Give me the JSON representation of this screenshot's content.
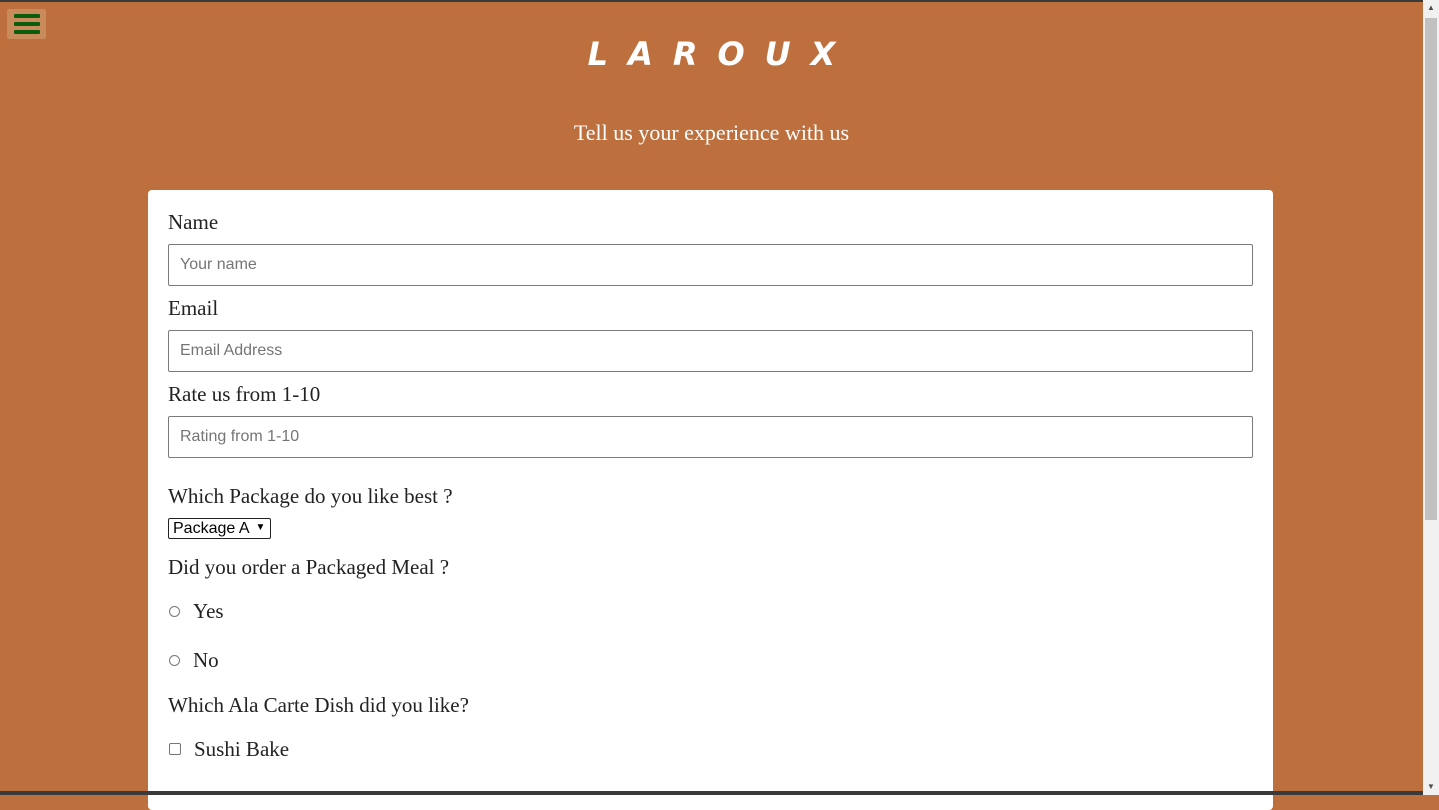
{
  "header": {
    "menu_icon": "hamburger-menu-icon",
    "brand": "LAROUX",
    "subtitle": "Tell us your experience with us"
  },
  "form": {
    "name": {
      "label": "Name",
      "placeholder": "Your name",
      "value": ""
    },
    "email": {
      "label": "Email",
      "placeholder": "Email Address",
      "value": ""
    },
    "rating": {
      "label": "Rate us from 1-10",
      "placeholder": "Rating from 1-10",
      "value": ""
    },
    "package": {
      "label": "Which Package do you like best ?",
      "selected": "Package A"
    },
    "packaged_meal": {
      "label": "Did you order a Packaged Meal ?",
      "options": [
        "Yes",
        "No"
      ]
    },
    "ala_carte": {
      "label": "Which Ala Carte Dish did you like?",
      "options": [
        "Sushi Bake"
      ]
    }
  },
  "colors": {
    "background": "#bd703d",
    "menu_bars": "#0b5d0b",
    "card": "#ffffff",
    "text": "#222222"
  }
}
